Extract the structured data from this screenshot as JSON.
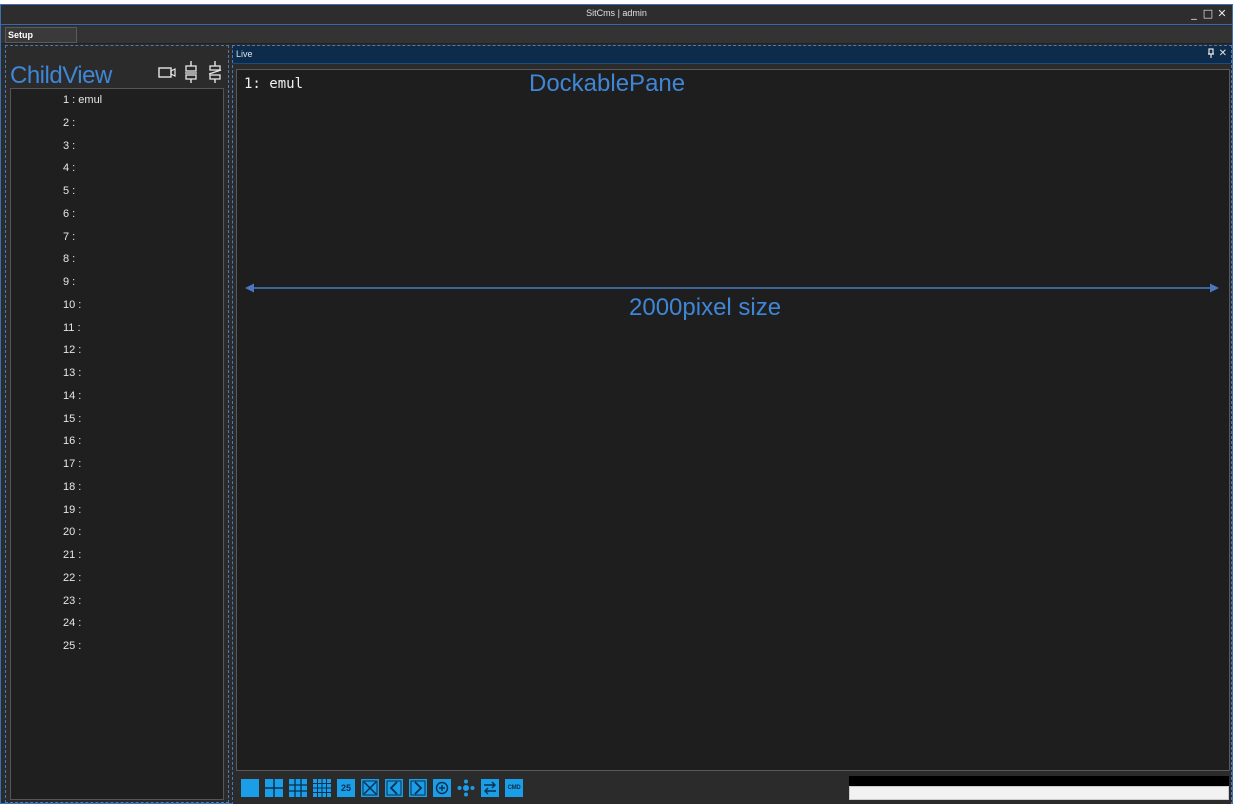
{
  "window": {
    "title": "SitCms | admin",
    "controls": {
      "minimize": "_",
      "maximize": "□",
      "close": "✕"
    }
  },
  "menu": {
    "setup": "Setup"
  },
  "childview": {
    "annotation": "ChildView",
    "icons": [
      "camera-icon",
      "connector-icon",
      "disconnect-icon"
    ],
    "items": [
      "1 : emul",
      "2 :",
      "3 :",
      "4 :",
      "5 :",
      "6 :",
      "7 :",
      "8 :",
      "9 :",
      "10 :",
      "11 :",
      "12 :",
      "13 :",
      "14 :",
      "15 :",
      "16 :",
      "17 :",
      "18 :",
      "19 :",
      "20 :",
      "21 :",
      "22 :",
      "23 :",
      "24 :",
      "25 :"
    ]
  },
  "pane": {
    "title": "Live",
    "pin": "⊣",
    "close": "✕",
    "channel_label": "1: emul",
    "annotation": "DockablePane",
    "size_annotation": "2000pixel size"
  },
  "toolbar": {
    "buttons": [
      "layout-1-icon",
      "layout-4-icon",
      "layout-9-icon",
      "layout-16-icon",
      "layout-25-icon",
      "fullscreen-icon",
      "prev-icon",
      "next-icon",
      "add-icon",
      "ptz-icon",
      "switch-icon",
      "cmd-icon"
    ],
    "layout_25_label": "25",
    "cmd_label": "CMD"
  },
  "colors": {
    "accent": "#1a9ee8",
    "annotation": "#3f86d6",
    "pane_header": "#0d2b4a"
  }
}
